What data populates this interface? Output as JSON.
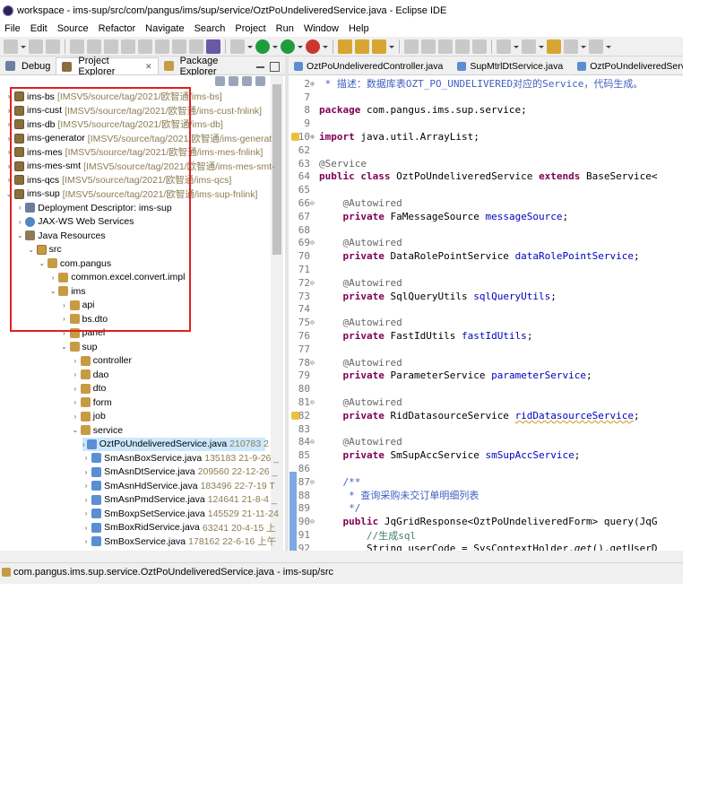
{
  "window": {
    "title": "workspace - ims-sup/src/com/pangus/ims/sup/service/OztPoUndeliveredService.java - Eclipse IDE"
  },
  "menu": [
    "File",
    "Edit",
    "Source",
    "Refactor",
    "Navigate",
    "Search",
    "Project",
    "Run",
    "Window",
    "Help"
  ],
  "left_tabs": [
    {
      "label": "Debug",
      "icon": "debug-icon"
    },
    {
      "label": "Project Explorer",
      "icon": "project-explorer-icon",
      "close": "✕",
      "active": true
    },
    {
      "label": "Package Explorer",
      "icon": "package-explorer-icon"
    }
  ],
  "tree": [
    {
      "indent": 0,
      "twisty": ">",
      "icon": "project",
      "label": "ims-bs",
      "dec": "[IMSV5/source/tag/2021/欧智通/ims-bs]"
    },
    {
      "indent": 0,
      "twisty": ">",
      "icon": "project",
      "label": "ims-cust",
      "dec": "[IMSV5/source/tag/2021/欧智通/ims-cust-fnlink]"
    },
    {
      "indent": 0,
      "twisty": ">",
      "icon": "project",
      "label": "ims-db",
      "dec": "[IMSV5/source/tag/2021/欧智通/ims-db]"
    },
    {
      "indent": 0,
      "twisty": ">",
      "icon": "project",
      "label": "ims-generator",
      "dec": "[IMSV5/source/tag/2021/欧智通/ims-generat"
    },
    {
      "indent": 0,
      "twisty": ">",
      "icon": "project",
      "label": "ims-mes",
      "dec": "[IMSV5/source/tag/2021/欧智通/ims-mes-fnlink]"
    },
    {
      "indent": 0,
      "twisty": ">",
      "icon": "project",
      "label": "ims-mes-smt",
      "dec": "[IMSV5/source/tag/2021/欧智通/ims-mes-smt-"
    },
    {
      "indent": 0,
      "twisty": ">",
      "icon": "project",
      "label": "ims-qcs",
      "dec": "[IMSV5/source/tag/2021/欧智通/ims-qcs]"
    },
    {
      "indent": 0,
      "twisty": "v",
      "icon": "project",
      "label": "ims-sup",
      "dec": "[IMSV5/source/tag/2021/欧智通/ims-sup-fnlink]"
    },
    {
      "indent": 1,
      "twisty": ">",
      "icon": "dd",
      "label": "Deployment Descriptor: ims-sup",
      "dec": ""
    },
    {
      "indent": 1,
      "twisty": ">",
      "icon": "ws",
      "label": "JAX-WS Web Services",
      "dec": ""
    },
    {
      "indent": 1,
      "twisty": "v",
      "icon": "jr",
      "label": "Java Resources",
      "dec": ""
    },
    {
      "indent": 2,
      "twisty": "v",
      "icon": "src",
      "label": "src",
      "dec": ""
    },
    {
      "indent": 3,
      "twisty": "v",
      "icon": "pkg",
      "label": "com.pangus",
      "dec": ""
    },
    {
      "indent": 4,
      "twisty": ">",
      "icon": "pkg",
      "label": "common.excel.convert.impl",
      "dec": ""
    },
    {
      "indent": 4,
      "twisty": "v",
      "icon": "pkg",
      "label": "ims",
      "dec": ""
    },
    {
      "indent": 5,
      "twisty": ">",
      "icon": "pkg",
      "label": "api",
      "dec": ""
    },
    {
      "indent": 5,
      "twisty": ">",
      "icon": "pkg",
      "label": "bs.dto",
      "dec": ""
    },
    {
      "indent": 5,
      "twisty": ">",
      "icon": "pkg",
      "label": "panel",
      "dec": ""
    },
    {
      "indent": 5,
      "twisty": "v",
      "icon": "pkg",
      "label": "sup",
      "dec": ""
    },
    {
      "indent": 6,
      "twisty": ">",
      "icon": "pkg",
      "label": "controller",
      "dec": ""
    },
    {
      "indent": 6,
      "twisty": ">",
      "icon": "pkg",
      "label": "dao",
      "dec": ""
    },
    {
      "indent": 6,
      "twisty": ">",
      "icon": "pkg",
      "label": "dto",
      "dec": ""
    },
    {
      "indent": 6,
      "twisty": ">",
      "icon": "pkg",
      "label": "form",
      "dec": ""
    },
    {
      "indent": 6,
      "twisty": ">",
      "icon": "pkg",
      "label": "job",
      "dec": ""
    },
    {
      "indent": 6,
      "twisty": "v",
      "icon": "pkg",
      "label": "service",
      "dec": ""
    },
    {
      "indent": 7,
      "twisty": ">",
      "icon": "java",
      "label": "OztPoUndeliveredService.java",
      "dec": "210783  2",
      "selected": true
    },
    {
      "indent": 7,
      "twisty": ">",
      "icon": "java",
      "label": "SmAsnBoxService.java",
      "dec": "135183  21-9-26 _"
    },
    {
      "indent": 7,
      "twisty": ">",
      "icon": "java",
      "label": "SmAsnDtService.java",
      "dec": "209560  22-12-26 _"
    },
    {
      "indent": 7,
      "twisty": ">",
      "icon": "java",
      "label": "SmAsnHdService.java",
      "dec": "183496  22-7-19 T"
    },
    {
      "indent": 7,
      "twisty": ">",
      "icon": "java",
      "label": "SmAsnPmdService.java",
      "dec": "124641  21-8-4 _"
    },
    {
      "indent": 7,
      "twisty": ">",
      "icon": "java",
      "label": "SmBoxpSetService.java",
      "dec": "145529  21-11-24"
    },
    {
      "indent": 7,
      "twisty": ">",
      "icon": "java",
      "label": "SmBoxRidService.java",
      "dec": "63241  20-4-15 上"
    },
    {
      "indent": 7,
      "twisty": ">",
      "icon": "java",
      "label": "SmBoxService.java",
      "dec": "178162  22-6-16 上午"
    }
  ],
  "editor_tabs": [
    {
      "label": "OztPoUndeliveredController.java"
    },
    {
      "label": "SupMtrlDtService.java"
    },
    {
      "label": "OztPoUndeliveredServ"
    }
  ],
  "code": [
    {
      "ln": "2",
      "fold": "⊕",
      "segs": [
        [
          "jd",
          " * 描述：数据库表OZT_PO_UNDELIVERED对应的Service，代码生成。"
        ]
      ]
    },
    {
      "ln": "7",
      "segs": []
    },
    {
      "ln": "8",
      "segs": [
        [
          "kw",
          "package"
        ],
        [
          "",
          " com.pangus.ims.sup.service;"
        ]
      ]
    },
    {
      "ln": "9",
      "segs": []
    },
    {
      "ln": "10",
      "fold": "⊕",
      "warn": true,
      "segs": [
        [
          "kw",
          "import"
        ],
        [
          "",
          " java.util.ArrayList;"
        ]
      ]
    },
    {
      "ln": "62",
      "segs": []
    },
    {
      "ln": "63",
      "segs": [
        [
          "an",
          "@Service"
        ]
      ]
    },
    {
      "ln": "64",
      "segs": [
        [
          "kw",
          "public class"
        ],
        [
          "",
          " OztPoUndeliveredService "
        ],
        [
          "kw",
          "extends"
        ],
        [
          "",
          " BaseService<"
        ]
      ]
    },
    {
      "ln": "65",
      "segs": []
    },
    {
      "ln": "66",
      "fold": "⊖",
      "segs": [
        [
          "",
          "    "
        ],
        [
          "an",
          "@Autowired"
        ]
      ]
    },
    {
      "ln": "67",
      "segs": [
        [
          "",
          "    "
        ],
        [
          "kw",
          "private"
        ],
        [
          "",
          " FaMessageSource "
        ],
        [
          "fld",
          "messageSource"
        ],
        [
          "",
          ";"
        ]
      ]
    },
    {
      "ln": "68",
      "segs": []
    },
    {
      "ln": "69",
      "fold": "⊖",
      "segs": [
        [
          "",
          "    "
        ],
        [
          "an",
          "@Autowired"
        ]
      ]
    },
    {
      "ln": "70",
      "segs": [
        [
          "",
          "    "
        ],
        [
          "kw",
          "private"
        ],
        [
          "",
          " DataRolePointService "
        ],
        [
          "fld",
          "dataRolePointService"
        ],
        [
          "",
          ";"
        ]
      ]
    },
    {
      "ln": "71",
      "segs": []
    },
    {
      "ln": "72",
      "fold": "⊖",
      "segs": [
        [
          "",
          "    "
        ],
        [
          "an",
          "@Autowired"
        ]
      ]
    },
    {
      "ln": "73",
      "segs": [
        [
          "",
          "    "
        ],
        [
          "kw",
          "private"
        ],
        [
          "",
          " SqlQueryUtils "
        ],
        [
          "fld",
          "sqlQueryUtils"
        ],
        [
          "",
          ";"
        ]
      ]
    },
    {
      "ln": "74",
      "segs": []
    },
    {
      "ln": "75",
      "fold": "⊖",
      "segs": [
        [
          "",
          "    "
        ],
        [
          "an",
          "@Autowired"
        ]
      ]
    },
    {
      "ln": "76",
      "segs": [
        [
          "",
          "    "
        ],
        [
          "kw",
          "private"
        ],
        [
          "",
          " FastIdUtils "
        ],
        [
          "fld",
          "fastIdUtils"
        ],
        [
          "",
          ";"
        ]
      ]
    },
    {
      "ln": "77",
      "segs": []
    },
    {
      "ln": "78",
      "fold": "⊖",
      "segs": [
        [
          "",
          "    "
        ],
        [
          "an",
          "@Autowired"
        ]
      ]
    },
    {
      "ln": "79",
      "segs": [
        [
          "",
          "    "
        ],
        [
          "kw",
          "private"
        ],
        [
          "",
          " ParameterService "
        ],
        [
          "fld",
          "parameterService"
        ],
        [
          "",
          ";"
        ]
      ]
    },
    {
      "ln": "80",
      "segs": []
    },
    {
      "ln": "81",
      "fold": "⊖",
      "segs": [
        [
          "",
          "    "
        ],
        [
          "an",
          "@Autowired"
        ]
      ]
    },
    {
      "ln": "82",
      "warn": true,
      "segs": [
        [
          "",
          "    "
        ],
        [
          "kw",
          "private"
        ],
        [
          "",
          " RidDatasourceService "
        ],
        [
          "fld ul",
          "ridDatasourceService"
        ],
        [
          "",
          ";"
        ]
      ]
    },
    {
      "ln": "83",
      "segs": []
    },
    {
      "ln": "84",
      "fold": "⊖",
      "segs": [
        [
          "",
          "    "
        ],
        [
          "an",
          "@Autowired"
        ]
      ]
    },
    {
      "ln": "85",
      "segs": [
        [
          "",
          "    "
        ],
        [
          "kw",
          "private"
        ],
        [
          "",
          " SmSupAccService "
        ],
        [
          "fld",
          "smSupAccService"
        ],
        [
          "",
          ";"
        ]
      ]
    },
    {
      "ln": "86",
      "segs": []
    },
    {
      "ln": "87",
      "fold": "⊖",
      "segs": [
        [
          "jd",
          "    /**"
        ]
      ]
    },
    {
      "ln": "88",
      "segs": [
        [
          "jd",
          "     * 查询采购未交订单明细列表"
        ]
      ]
    },
    {
      "ln": "89",
      "segs": [
        [
          "jd",
          "     */"
        ]
      ]
    },
    {
      "ln": "90",
      "fold": "⊖",
      "segs": [
        [
          "",
          "    "
        ],
        [
          "kw",
          "public"
        ],
        [
          "",
          " JqGridResponse<OztPoUndeliveredForm> query(JqG"
        ]
      ]
    },
    {
      "ln": "91",
      "segs": [
        [
          "cm",
          "        //生成sql"
        ]
      ]
    },
    {
      "ln": "92",
      "segs": [
        [
          "",
          "        String "
        ],
        [
          "ul",
          "userCode"
        ],
        [
          "",
          " = SysContextHolder."
        ],
        [
          "it",
          "get"
        ],
        [
          "",
          "().getUserD"
        ]
      ]
    }
  ],
  "status": {
    "text": "com.pangus.ims.sup.service.OztPoUndeliveredService.java - ims-sup/src"
  }
}
